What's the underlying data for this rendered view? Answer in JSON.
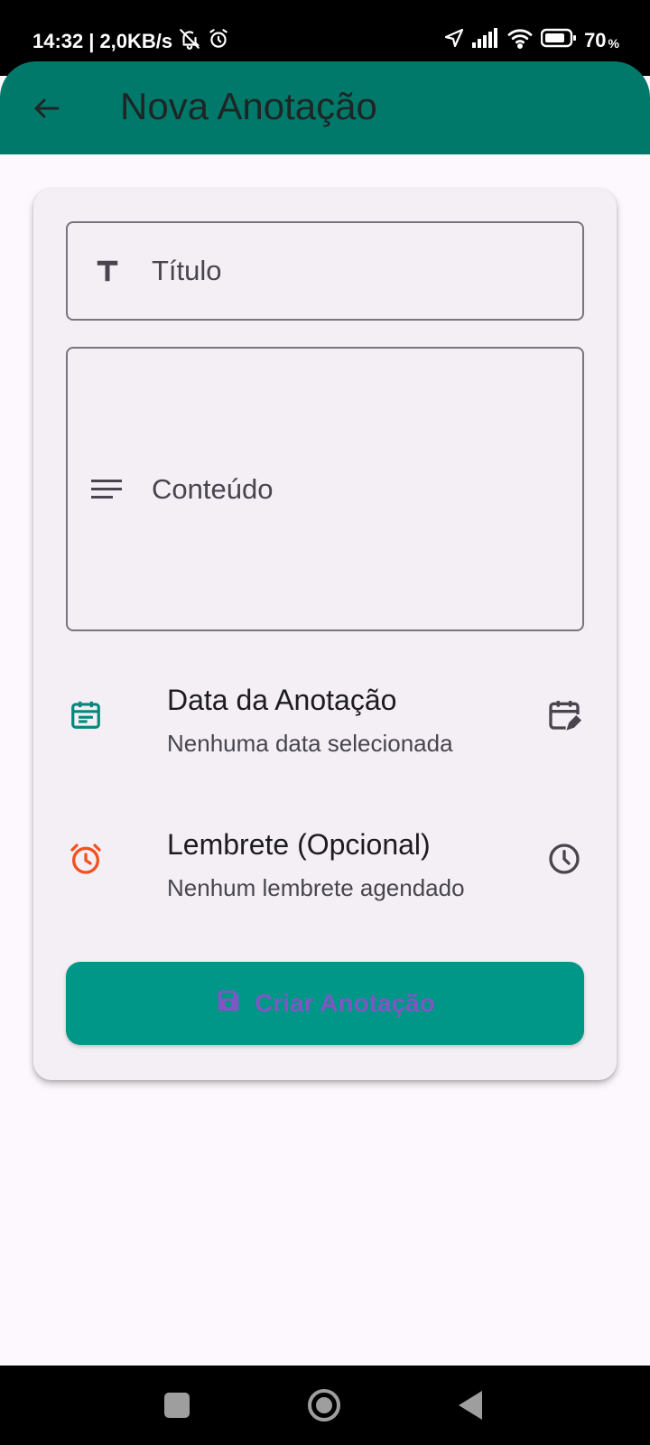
{
  "status_bar": {
    "time": "14:32",
    "separator": "|",
    "speed": "2,0KB/s",
    "battery": "70",
    "battery_unit": "%"
  },
  "app_bar": {
    "title": "Nova Anotação",
    "back_icon": "arrow-back-icon"
  },
  "form": {
    "title_field": {
      "label": "Título",
      "icon": "title-text-icon"
    },
    "content_field": {
      "label": "Conteúdo",
      "icon": "notes-lines-icon"
    },
    "date_row": {
      "title": "Data da Anotação",
      "subtitle": "Nenhuma data selecionada",
      "leading_icon": "calendar-icon",
      "trailing_icon": "edit-calendar-icon"
    },
    "reminder_row": {
      "title": "Lembrete (Opcional)",
      "subtitle": "Nenhum lembrete agendado",
      "leading_icon": "alarm-icon",
      "trailing_icon": "clock-icon"
    },
    "create_button": {
      "label": "Criar Anotação",
      "icon": "save-icon"
    }
  },
  "colors": {
    "app_bar": "#00796b",
    "button": "#009688",
    "button_text": "#7e57c2",
    "date_icon": "#00897b",
    "alarm_icon": "#f4511e",
    "background": "#fdf8fd",
    "card": "#f3eff5"
  }
}
